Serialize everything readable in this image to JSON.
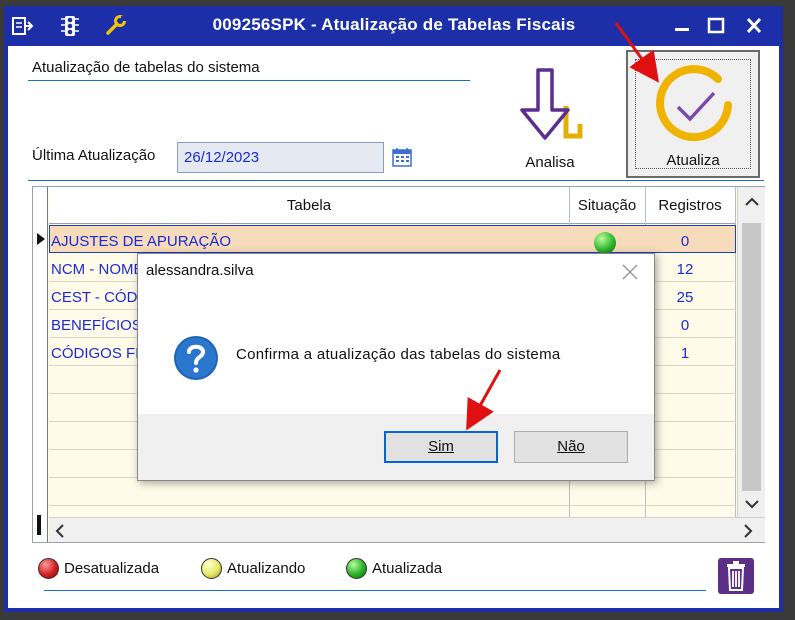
{
  "window": {
    "title": "009256SPK - Atualização de Tabelas Fiscais"
  },
  "section_title": "Atualização de tabelas do sistema",
  "ultima": {
    "label": "Última Atualização",
    "value": "26/12/2023"
  },
  "toolbar": {
    "analisa_label": "Analisa",
    "atualiza_label": "Atualiza"
  },
  "grid": {
    "columns": [
      "Tabela",
      "Situação",
      "Registros"
    ],
    "rows": [
      {
        "tabela": "AJUSTES DE APURAÇÃO",
        "registros": "0",
        "status_color": "#2fb52f"
      },
      {
        "tabela": "NCM - NOME",
        "registros": "12"
      },
      {
        "tabela": "CEST - CÓD",
        "registros": "25"
      },
      {
        "tabela": "BENEFÍCIOS",
        "registros": "0"
      },
      {
        "tabela": "CÓDIGOS FI",
        "registros": "1"
      }
    ]
  },
  "legend": [
    {
      "label": "Desatualizada",
      "color": "#d42020"
    },
    {
      "label": "Atualizando",
      "color": "#e6e86a"
    },
    {
      "label": "Atualizada",
      "color": "#28b028"
    }
  ],
  "dialog": {
    "title": "alessandra.silva",
    "message": "Confirma a atualização das tabelas do sistema",
    "yes_label": "Sim",
    "no_label": "Não"
  },
  "colors": {
    "title_bar": "#1c2fa8",
    "accent_text": "#1b2ad6",
    "annotation_arrow": "#e01010"
  }
}
